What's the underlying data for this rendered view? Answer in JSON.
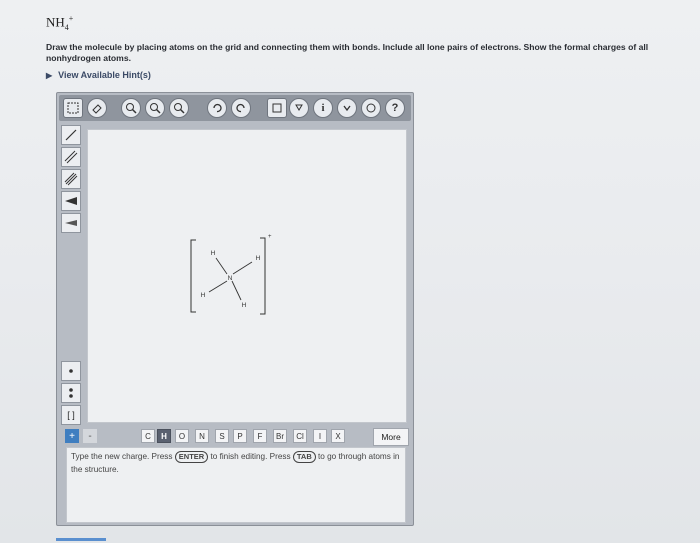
{
  "question": {
    "formula": {
      "base": "NH",
      "sub": "4",
      "sup": "+"
    },
    "prompt": "Draw the molecule by placing atoms on the grid and connecting them with bonds. Include all lone pairs of electrons. Show the formal charges of all nonhydrogen atoms.",
    "hint_link": "View Available Hint(s)"
  },
  "toolbar": {
    "icons": [
      "eraser-icon",
      "zoom-out-icon",
      "zoom-reset-icon",
      "zoom-in-icon",
      "undo-icon",
      "redo-icon",
      "template-icon",
      "periodic-icon",
      "info-icon",
      "expand-icon",
      "help-icon"
    ]
  },
  "left_tools": [
    "single-bond",
    "double-bond",
    "triple-bond",
    "wedge-bond",
    "hash-bond",
    "lone-pair",
    "radical",
    "brackets"
  ],
  "molecule": {
    "atoms": [
      {
        "label": "N",
        "role": "center"
      },
      {
        "label": "H",
        "role": "top"
      },
      {
        "label": "H",
        "role": "right"
      },
      {
        "label": "H",
        "role": "left"
      },
      {
        "label": "H",
        "role": "bottom"
      }
    ],
    "bracket_charge": "+"
  },
  "atom_bar": {
    "plus": "+",
    "minus": "-",
    "atoms": [
      "C",
      "H",
      "O",
      "N",
      "S",
      "P",
      "F",
      "Br",
      "Cl",
      "I",
      "X"
    ],
    "selected": "H",
    "more_label": "More"
  },
  "info": {
    "t1": "Type the new charge. Press",
    "k1": "ENTER",
    "t2": "to finish editing. Press",
    "k2": "TAB",
    "t3": "to go through atoms in the structure."
  }
}
